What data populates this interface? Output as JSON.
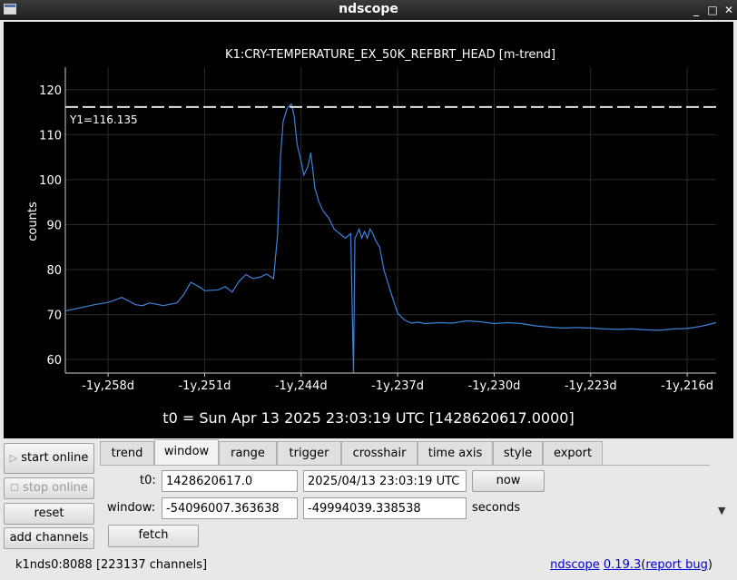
{
  "window": {
    "title": "ndscope"
  },
  "plot": {
    "title": "K1:CRY-TEMPERATURE_EX_50K_REFBRT_HEAD [m-trend]",
    "ylabel": "counts",
    "cursor_label": "Y1=116.135",
    "t0_label": "t0 = Sun Apr 13 2025 23:03:19 UTC [1428620617.0000]",
    "line_color": "#3c82dc"
  },
  "chart_data": {
    "type": "line",
    "ylabel": "counts",
    "ylim": [
      57,
      125
    ],
    "yticks": [
      60,
      70,
      80,
      90,
      100,
      110,
      120
    ],
    "xlim": [
      -261.1,
      -213.9
    ],
    "x_units": "days (relative to t0, labels prefixed -1y)",
    "xticks": [
      -258,
      -251,
      -244,
      -237,
      -230,
      -223,
      -216
    ],
    "xtick_labels": [
      "-1y,258d",
      "-1y,251d",
      "-1y,244d",
      "-1y,237d",
      "-1y,230d",
      "-1y,223d",
      "-1y,216d"
    ],
    "cursor_y": 116.135,
    "series": [
      {
        "x": [
          -261.1,
          -260,
          -259,
          -258,
          -257,
          -256,
          -255.5,
          -255,
          -254,
          -253,
          -252.5,
          -252,
          -251.3,
          -251,
          -250,
          -249.5,
          -249,
          -248.5,
          -248,
          -247.5,
          -247,
          -246.5,
          -246,
          -245.7,
          -245.5,
          -245.3,
          -245,
          -244.7,
          -244.5,
          -244.3,
          -244,
          -243.8,
          -243.5,
          -243.3,
          -243,
          -242.7,
          -242.4,
          -242,
          -241.6,
          -241.2,
          -240.8,
          -240.4,
          -240.2,
          -240.1,
          -240,
          -239.8,
          -239.6,
          -239.4,
          -239.2,
          -239,
          -238.8,
          -238.6,
          -238.3,
          -238,
          -237.5,
          -237,
          -236.5,
          -236,
          -235.5,
          -235,
          -234,
          -233,
          -232,
          -231,
          -230,
          -229,
          -228,
          -227,
          -226,
          -225,
          -224,
          -223,
          -222,
          -221,
          -220,
          -219,
          -218,
          -217,
          -216,
          -215,
          -213.9
        ],
        "y": [
          70.8,
          71.5,
          72.2,
          72.7,
          73.8,
          72.2,
          72.0,
          72.6,
          72.0,
          72.6,
          74.5,
          77.2,
          76.0,
          75.3,
          75.5,
          76.2,
          75.0,
          77.4,
          78.9,
          78.0,
          78.3,
          79.0,
          78.0,
          88.0,
          105.0,
          113.0,
          116.0,
          116.8,
          114.0,
          108.0,
          104.0,
          101.0,
          103.0,
          106.0,
          98.0,
          95.0,
          93.0,
          91.5,
          89.0,
          88.0,
          87.0,
          88.0,
          57.0,
          87.0,
          87.5,
          89.0,
          87.0,
          88.5,
          87.0,
          89.0,
          88.0,
          86.5,
          85.0,
          80.0,
          75.0,
          70.3,
          68.8,
          68.1,
          68.3,
          68.0,
          68.2,
          68.1,
          68.6,
          68.4,
          68.0,
          68.2,
          68.0,
          67.5,
          67.2,
          67.0,
          67.1,
          67.0,
          66.8,
          66.7,
          66.8,
          66.6,
          66.5,
          66.8,
          66.9,
          67.4,
          68.2
        ]
      }
    ]
  },
  "controls": {
    "start_online": "start online",
    "stop_online": "stop online",
    "reset": "reset",
    "add_channels": "add channels"
  },
  "tabs": [
    {
      "label": "trend"
    },
    {
      "label": "window"
    },
    {
      "label": "range"
    },
    {
      "label": "trigger"
    },
    {
      "label": "crosshair"
    },
    {
      "label": "time axis"
    },
    {
      "label": "style"
    },
    {
      "label": "export"
    }
  ],
  "window_tab": {
    "t0_label": "t0:",
    "t0_gps": "1428620617.0",
    "t0_utc": "2025/04/13 23:03:19 UTC",
    "now_button": "now",
    "window_label": "window:",
    "window_start": "-54096007.363638",
    "window_end": "-49994039.338538",
    "seconds_label": "seconds",
    "fetch_button": "fetch"
  },
  "status": {
    "server": "k1nds0:8088",
    "channels": "[223137 channels]",
    "app_name": "ndscope",
    "version": "0.19.3",
    "paren_open": "(",
    "report_bug": "report bug",
    "paren_close": ")"
  }
}
